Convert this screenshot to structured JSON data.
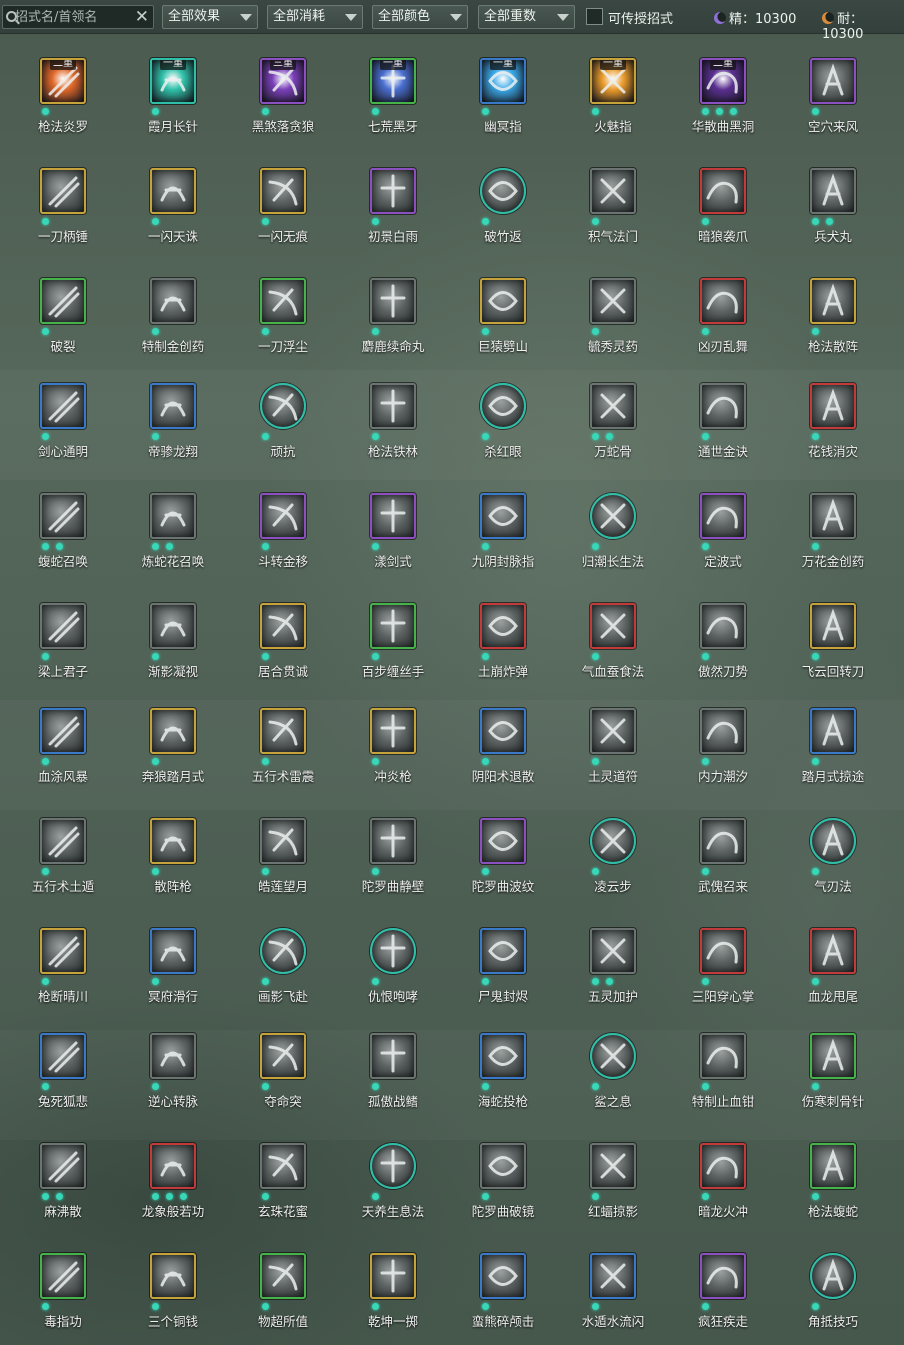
{
  "filters": {
    "search_placeholder": "招式名/首领名",
    "clear_icon": "✕",
    "effect": "全部效果",
    "cost": "全部消耗",
    "color": "全部颜色",
    "weight": "全部重数",
    "transferable_label": "可传授招式"
  },
  "resources": [
    {
      "label": "精：10300",
      "color": "#8f6fd8",
      "icon": "spirit-moon-icon"
    },
    {
      "label": "耐：10300",
      "color": "#d98a3a",
      "icon": "stamina-moon-icon"
    }
  ],
  "frame_colors": {
    "gold": "#c6a23a",
    "blue": "#3a78c8",
    "purple": "#8b4fc0",
    "green": "#46b34a",
    "red": "#c23a3a",
    "teal": "#2fbfa8",
    "gray": "#6c7472"
  },
  "skills": [
    {
      "name": "枪法炎罗",
      "frame": "gold",
      "tier": "二重",
      "dots": 1,
      "round": false,
      "tint": "#e0682a"
    },
    {
      "name": "霞月长针",
      "frame": "teal",
      "tier": "一重",
      "dots": 1,
      "round": false,
      "tint": "#2fbfa8"
    },
    {
      "name": "黑煞落贪狼",
      "frame": "purple",
      "tier": "三重",
      "dots": 1,
      "round": false,
      "tint": "#7a3fb8"
    },
    {
      "name": "七荒黑牙",
      "frame": "green",
      "tier": "一重",
      "dots": 1,
      "round": false,
      "tint": "#4a6fd0"
    },
    {
      "name": "幽冥指",
      "frame": "blue",
      "tier": "一重",
      "dots": 1,
      "round": false,
      "tint": "#3aa8e8"
    },
    {
      "name": "火魅指",
      "frame": "gold",
      "tier": "一重",
      "dots": 1,
      "round": false,
      "tint": "#e89a2a"
    },
    {
      "name": "华散曲黑洞",
      "frame": "purple",
      "tier": "二重",
      "dots": 3,
      "round": false,
      "tint": "#5a2f90"
    },
    {
      "name": "空穴来风",
      "frame": "purple",
      "tier": "",
      "dots": 1,
      "round": false,
      "tint": ""
    },
    {
      "name": "一刀柄锤",
      "frame": "gold",
      "tier": "",
      "dots": 1,
      "round": false,
      "tint": ""
    },
    {
      "name": "一闪天诛",
      "frame": "gold",
      "tier": "",
      "dots": 1,
      "round": false,
      "tint": ""
    },
    {
      "name": "一闪无痕",
      "frame": "gold",
      "tier": "",
      "dots": 1,
      "round": false,
      "tint": ""
    },
    {
      "name": "初景白雨",
      "frame": "purple",
      "tier": "",
      "dots": 1,
      "round": false,
      "tint": ""
    },
    {
      "name": "破竹返",
      "frame": "teal",
      "tier": "",
      "dots": 1,
      "round": true,
      "tint": ""
    },
    {
      "name": "积气法门",
      "frame": "gray",
      "tier": "",
      "dots": 1,
      "round": false,
      "tint": ""
    },
    {
      "name": "暗狼袭爪",
      "frame": "red",
      "tier": "",
      "dots": 1,
      "round": false,
      "tint": ""
    },
    {
      "name": "兵犬丸",
      "frame": "gray",
      "tier": "",
      "dots": 2,
      "round": false,
      "tint": ""
    },
    {
      "name": "破裂",
      "frame": "green",
      "tier": "",
      "dots": 1,
      "round": false,
      "tint": ""
    },
    {
      "name": "特制金创药",
      "frame": "gray",
      "tier": "",
      "dots": 1,
      "round": false,
      "tint": ""
    },
    {
      "name": "一刀浮尘",
      "frame": "green",
      "tier": "",
      "dots": 1,
      "round": false,
      "tint": ""
    },
    {
      "name": "麝鹿续命丸",
      "frame": "gray",
      "tier": "",
      "dots": 1,
      "round": false,
      "tint": ""
    },
    {
      "name": "巨猿劈山",
      "frame": "gold",
      "tier": "",
      "dots": 1,
      "round": false,
      "tint": ""
    },
    {
      "name": "毓秀灵药",
      "frame": "gray",
      "tier": "",
      "dots": 1,
      "round": false,
      "tint": ""
    },
    {
      "name": "凶刃乱舞",
      "frame": "red",
      "tier": "",
      "dots": 1,
      "round": false,
      "tint": ""
    },
    {
      "name": "枪法散阵",
      "frame": "gold",
      "tier": "",
      "dots": 1,
      "round": false,
      "tint": ""
    },
    {
      "name": "剑心通明",
      "frame": "blue",
      "tier": "",
      "dots": 1,
      "round": false,
      "tint": ""
    },
    {
      "name": "帝骖龙翔",
      "frame": "blue",
      "tier": "",
      "dots": 1,
      "round": false,
      "tint": ""
    },
    {
      "name": "顽抗",
      "frame": "teal",
      "tier": "",
      "dots": 1,
      "round": true,
      "tint": ""
    },
    {
      "name": "枪法铁林",
      "frame": "gray",
      "tier": "",
      "dots": 1,
      "round": false,
      "tint": ""
    },
    {
      "name": "杀红眼",
      "frame": "teal",
      "tier": "",
      "dots": 1,
      "round": true,
      "tint": ""
    },
    {
      "name": "万蛇骨",
      "frame": "gray",
      "tier": "",
      "dots": 2,
      "round": false,
      "tint": ""
    },
    {
      "name": "通世金诀",
      "frame": "gray",
      "tier": "",
      "dots": 1,
      "round": false,
      "tint": ""
    },
    {
      "name": "花钱消灾",
      "frame": "red",
      "tier": "",
      "dots": 1,
      "round": false,
      "tint": ""
    },
    {
      "name": "蝮蛇召唤",
      "frame": "gray",
      "tier": "",
      "dots": 2,
      "round": false,
      "tint": ""
    },
    {
      "name": "炼蛇花召唤",
      "frame": "gray",
      "tier": "",
      "dots": 2,
      "round": false,
      "tint": ""
    },
    {
      "name": "斗转金移",
      "frame": "purple",
      "tier": "",
      "dots": 1,
      "round": false,
      "tint": ""
    },
    {
      "name": "漾剑式",
      "frame": "purple",
      "tier": "",
      "dots": 1,
      "round": false,
      "tint": ""
    },
    {
      "name": "九阴封脉指",
      "frame": "blue",
      "tier": "",
      "dots": 1,
      "round": false,
      "tint": ""
    },
    {
      "name": "归潮长生法",
      "frame": "teal",
      "tier": "",
      "dots": 1,
      "round": true,
      "tint": ""
    },
    {
      "name": "定波式",
      "frame": "purple",
      "tier": "",
      "dots": 1,
      "round": false,
      "tint": ""
    },
    {
      "name": "万花金创药",
      "frame": "gray",
      "tier": "",
      "dots": 1,
      "round": false,
      "tint": ""
    },
    {
      "name": "梁上君子",
      "frame": "gray",
      "tier": "",
      "dots": 1,
      "round": false,
      "tint": ""
    },
    {
      "name": "渐影凝视",
      "frame": "gray",
      "tier": "",
      "dots": 1,
      "round": false,
      "tint": ""
    },
    {
      "name": "居合贯诚",
      "frame": "gold",
      "tier": "",
      "dots": 1,
      "round": false,
      "tint": ""
    },
    {
      "name": "百步缠丝手",
      "frame": "green",
      "tier": "",
      "dots": 1,
      "round": false,
      "tint": ""
    },
    {
      "name": "土崩炸弹",
      "frame": "red",
      "tier": "",
      "dots": 1,
      "round": false,
      "tint": ""
    },
    {
      "name": "气血蚕食法",
      "frame": "red",
      "tier": "",
      "dots": 1,
      "round": false,
      "tint": ""
    },
    {
      "name": "傲然刀势",
      "frame": "gray",
      "tier": "",
      "dots": 1,
      "round": false,
      "tint": ""
    },
    {
      "name": "飞云回转刀",
      "frame": "gold",
      "tier": "",
      "dots": 1,
      "round": false,
      "tint": ""
    },
    {
      "name": "血涂风暴",
      "frame": "blue",
      "tier": "",
      "dots": 1,
      "round": false,
      "tint": ""
    },
    {
      "name": "奔狼踏月式",
      "frame": "gold",
      "tier": "",
      "dots": 1,
      "round": false,
      "tint": ""
    },
    {
      "name": "五行术雷震",
      "frame": "gold",
      "tier": "",
      "dots": 1,
      "round": false,
      "tint": ""
    },
    {
      "name": "冲炎枪",
      "frame": "gold",
      "tier": "",
      "dots": 1,
      "round": false,
      "tint": ""
    },
    {
      "name": "阴阳术退散",
      "frame": "blue",
      "tier": "",
      "dots": 1,
      "round": false,
      "tint": ""
    },
    {
      "name": "土灵道符",
      "frame": "gray",
      "tier": "",
      "dots": 1,
      "round": false,
      "tint": ""
    },
    {
      "name": "内力潮汐",
      "frame": "gray",
      "tier": "",
      "dots": 1,
      "round": false,
      "tint": ""
    },
    {
      "name": "踏月式掠途",
      "frame": "blue",
      "tier": "",
      "dots": 1,
      "round": false,
      "tint": ""
    },
    {
      "name": "五行术土遁",
      "frame": "gray",
      "tier": "",
      "dots": 1,
      "round": false,
      "tint": ""
    },
    {
      "name": "散阵枪",
      "frame": "gold",
      "tier": "",
      "dots": 1,
      "round": false,
      "tint": ""
    },
    {
      "name": "皓莲望月",
      "frame": "gray",
      "tier": "",
      "dots": 1,
      "round": false,
      "tint": ""
    },
    {
      "name": "陀罗曲静壁",
      "frame": "gray",
      "tier": "",
      "dots": 1,
      "round": false,
      "tint": ""
    },
    {
      "name": "陀罗曲波纹",
      "frame": "purple",
      "tier": "",
      "dots": 1,
      "round": false,
      "tint": ""
    },
    {
      "name": "凌云步",
      "frame": "teal",
      "tier": "",
      "dots": 1,
      "round": true,
      "tint": ""
    },
    {
      "name": "武傀召来",
      "frame": "gray",
      "tier": "",
      "dots": 1,
      "round": false,
      "tint": ""
    },
    {
      "name": "气刃法",
      "frame": "teal",
      "tier": "",
      "dots": 1,
      "round": true,
      "tint": ""
    },
    {
      "name": "枪断晴川",
      "frame": "gold",
      "tier": "",
      "dots": 1,
      "round": false,
      "tint": ""
    },
    {
      "name": "冥府滑行",
      "frame": "blue",
      "tier": "",
      "dots": 1,
      "round": false,
      "tint": ""
    },
    {
      "name": "画影飞赴",
      "frame": "teal",
      "tier": "",
      "dots": 1,
      "round": true,
      "tint": ""
    },
    {
      "name": "仇恨咆哮",
      "frame": "teal",
      "tier": "",
      "dots": 1,
      "round": true,
      "tint": ""
    },
    {
      "name": "尸鬼封烬",
      "frame": "blue",
      "tier": "",
      "dots": 1,
      "round": false,
      "tint": ""
    },
    {
      "name": "五灵加护",
      "frame": "gray",
      "tier": "",
      "dots": 2,
      "round": false,
      "tint": ""
    },
    {
      "name": "三阳穿心掌",
      "frame": "red",
      "tier": "",
      "dots": 1,
      "round": false,
      "tint": ""
    },
    {
      "name": "血龙甩尾",
      "frame": "red",
      "tier": "",
      "dots": 1,
      "round": false,
      "tint": ""
    },
    {
      "name": "兔死狐悲",
      "frame": "blue",
      "tier": "",
      "dots": 1,
      "round": false,
      "tint": ""
    },
    {
      "name": "逆心转脉",
      "frame": "gray",
      "tier": "",
      "dots": 1,
      "round": false,
      "tint": ""
    },
    {
      "name": "夺命突",
      "frame": "gold",
      "tier": "",
      "dots": 1,
      "round": false,
      "tint": ""
    },
    {
      "name": "孤傲战鳍",
      "frame": "gray",
      "tier": "",
      "dots": 1,
      "round": false,
      "tint": ""
    },
    {
      "name": "海蛇投枪",
      "frame": "blue",
      "tier": "",
      "dots": 1,
      "round": false,
      "tint": ""
    },
    {
      "name": "鲨之息",
      "frame": "teal",
      "tier": "",
      "dots": 1,
      "round": true,
      "tint": ""
    },
    {
      "name": "特制止血钳",
      "frame": "gray",
      "tier": "",
      "dots": 1,
      "round": false,
      "tint": ""
    },
    {
      "name": "伤寒刺骨针",
      "frame": "green",
      "tier": "",
      "dots": 1,
      "round": false,
      "tint": ""
    },
    {
      "name": "麻沸散",
      "frame": "gray",
      "tier": "",
      "dots": 2,
      "round": false,
      "tint": ""
    },
    {
      "name": "龙象般若功",
      "frame": "red",
      "tier": "",
      "dots": 3,
      "round": false,
      "tint": ""
    },
    {
      "name": "玄珠花蜜",
      "frame": "gray",
      "tier": "",
      "dots": 1,
      "round": false,
      "tint": ""
    },
    {
      "name": "天养生息法",
      "frame": "teal",
      "tier": "",
      "dots": 1,
      "round": true,
      "tint": ""
    },
    {
      "name": "陀罗曲破镜",
      "frame": "gray",
      "tier": "",
      "dots": 1,
      "round": false,
      "tint": ""
    },
    {
      "name": "红蝠掠影",
      "frame": "gray",
      "tier": "",
      "dots": 1,
      "round": false,
      "tint": ""
    },
    {
      "name": "暗龙火冲",
      "frame": "red",
      "tier": "",
      "dots": 1,
      "round": false,
      "tint": ""
    },
    {
      "name": "枪法蝮蛇",
      "frame": "green",
      "tier": "",
      "dots": 1,
      "round": false,
      "tint": ""
    },
    {
      "name": "毒指功",
      "frame": "green",
      "tier": "",
      "dots": 1,
      "round": false,
      "tint": ""
    },
    {
      "name": "三个铜钱",
      "frame": "gold",
      "tier": "",
      "dots": 1,
      "round": false,
      "tint": ""
    },
    {
      "name": "物超所值",
      "frame": "green",
      "tier": "",
      "dots": 1,
      "round": false,
      "tint": ""
    },
    {
      "name": "乾坤一掷",
      "frame": "gold",
      "tier": "",
      "dots": 1,
      "round": false,
      "tint": ""
    },
    {
      "name": "蛮熊碎颅击",
      "frame": "blue",
      "tier": "",
      "dots": 1,
      "round": false,
      "tint": ""
    },
    {
      "name": "水遁水流闪",
      "frame": "blue",
      "tier": "",
      "dots": 1,
      "round": false,
      "tint": ""
    },
    {
      "name": "疯狂疾走",
      "frame": "purple",
      "tier": "",
      "dots": 1,
      "round": false,
      "tint": ""
    },
    {
      "name": "角抵技巧",
      "frame": "teal",
      "tier": "",
      "dots": 1,
      "round": true,
      "tint": ""
    }
  ]
}
